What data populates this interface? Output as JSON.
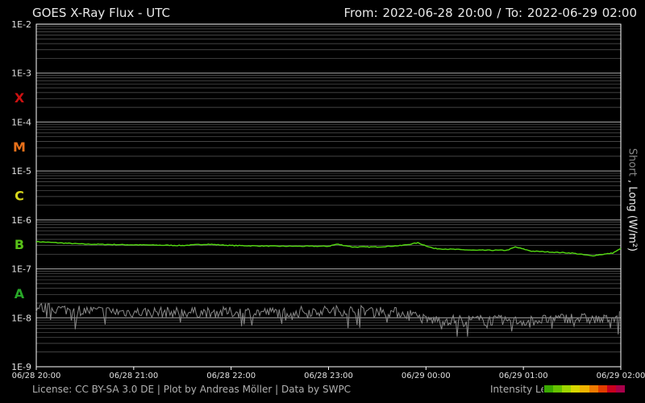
{
  "header": {
    "title": "GOES X-Ray Flux - UTC",
    "range": "From: 2022-06-28 20:00  /  To: 2022-06-29 02:00"
  },
  "axis_title": {
    "short": "Short",
    "sep": " , ",
    "long": "Long (W/m²)"
  },
  "footer": {
    "license": "License: CC BY-SA 3.0 DE | Plot by Andreas Möller | Data by SWPC",
    "legend_label": "Intensity Legend",
    "legend_colors": [
      "#3aa800",
      "#66c200",
      "#9ed600",
      "#d8d800",
      "#f0b400",
      "#ee7a00",
      "#e23c00",
      "#c8001e",
      "#a8004a"
    ]
  },
  "chart_data": {
    "type": "line",
    "title": "GOES X-Ray Flux - UTC",
    "ylabel": "Short , Long (W/m²)",
    "yscale": "log",
    "ylim": [
      1e-09,
      0.01
    ],
    "ytick_labels": [
      "1E-2",
      "1E-3",
      "1E-4",
      "1E-5",
      "1E-6",
      "1E-7",
      "1E-8",
      "1E-9"
    ],
    "ytick_exponents": [
      -2,
      -3,
      -4,
      -5,
      -6,
      -7,
      -8,
      -9
    ],
    "xtick_labels": [
      "06/28 20:00",
      "06/28 21:00",
      "06/28 22:00",
      "06/28 23:00",
      "06/29 00:00",
      "06/29 01:00",
      "06/29 02:00"
    ],
    "xlim": [
      "2022-06-28 20:00",
      "2022-06-29 02:00"
    ],
    "grid": true,
    "flare_classes": [
      {
        "label": "X",
        "color": "#cc1111",
        "exp": -3.5
      },
      {
        "label": "M",
        "color": "#e8701a",
        "exp": -4.5
      },
      {
        "label": "C",
        "color": "#d6d61c",
        "exp": -5.5
      },
      {
        "label": "B",
        "color": "#58c018",
        "exp": -6.5
      },
      {
        "label": "A",
        "color": "#28a828",
        "exp": -7.5
      }
    ],
    "series": [
      {
        "name": "Long",
        "color": "#55dd11",
        "points": [
          [
            "20:00",
            3.6e-07
          ],
          [
            "20:30",
            3.2e-07
          ],
          [
            "21:00",
            3.1e-07
          ],
          [
            "21:30",
            3e-07
          ],
          [
            "21:45",
            3.2e-07
          ],
          [
            "22:00",
            3e-07
          ],
          [
            "22:30",
            2.9e-07
          ],
          [
            "23:00",
            2.9e-07
          ],
          [
            "23:05",
            3.2e-07
          ],
          [
            "23:15",
            2.8e-07
          ],
          [
            "23:30",
            2.8e-07
          ],
          [
            "23:45",
            3e-07
          ],
          [
            "23:55",
            3.4e-07
          ],
          [
            "00:05",
            2.6e-07
          ],
          [
            "00:30",
            2.4e-07
          ],
          [
            "00:50",
            2.4e-07
          ],
          [
            "00:55",
            2.8e-07
          ],
          [
            "01:05",
            2.3e-07
          ],
          [
            "01:30",
            2.1e-07
          ],
          [
            "01:42",
            1.85e-07
          ],
          [
            "01:55",
            2.1e-07
          ],
          [
            "02:00",
            2.6e-07
          ]
        ]
      },
      {
        "name": "Short",
        "color": "#8a8a8a",
        "points": [
          [
            "20:00",
            1.6e-08
          ],
          [
            "20:30",
            1.4e-08
          ],
          [
            "21:00",
            1.3e-08
          ],
          [
            "21:30",
            1.3e-08
          ],
          [
            "22:00",
            1.3e-08
          ],
          [
            "22:30",
            1.3e-08
          ],
          [
            "23:00",
            1.4e-08
          ],
          [
            "23:30",
            1.4e-08
          ],
          [
            "23:50",
            1.2e-08
          ],
          [
            "00:00",
            9e-09
          ],
          [
            "00:30",
            9e-09
          ],
          [
            "01:00",
            8.5e-09
          ],
          [
            "01:30",
            1e-08
          ],
          [
            "01:50",
            9e-09
          ],
          [
            "02:00",
            1.2e-08
          ]
        ]
      }
    ]
  }
}
